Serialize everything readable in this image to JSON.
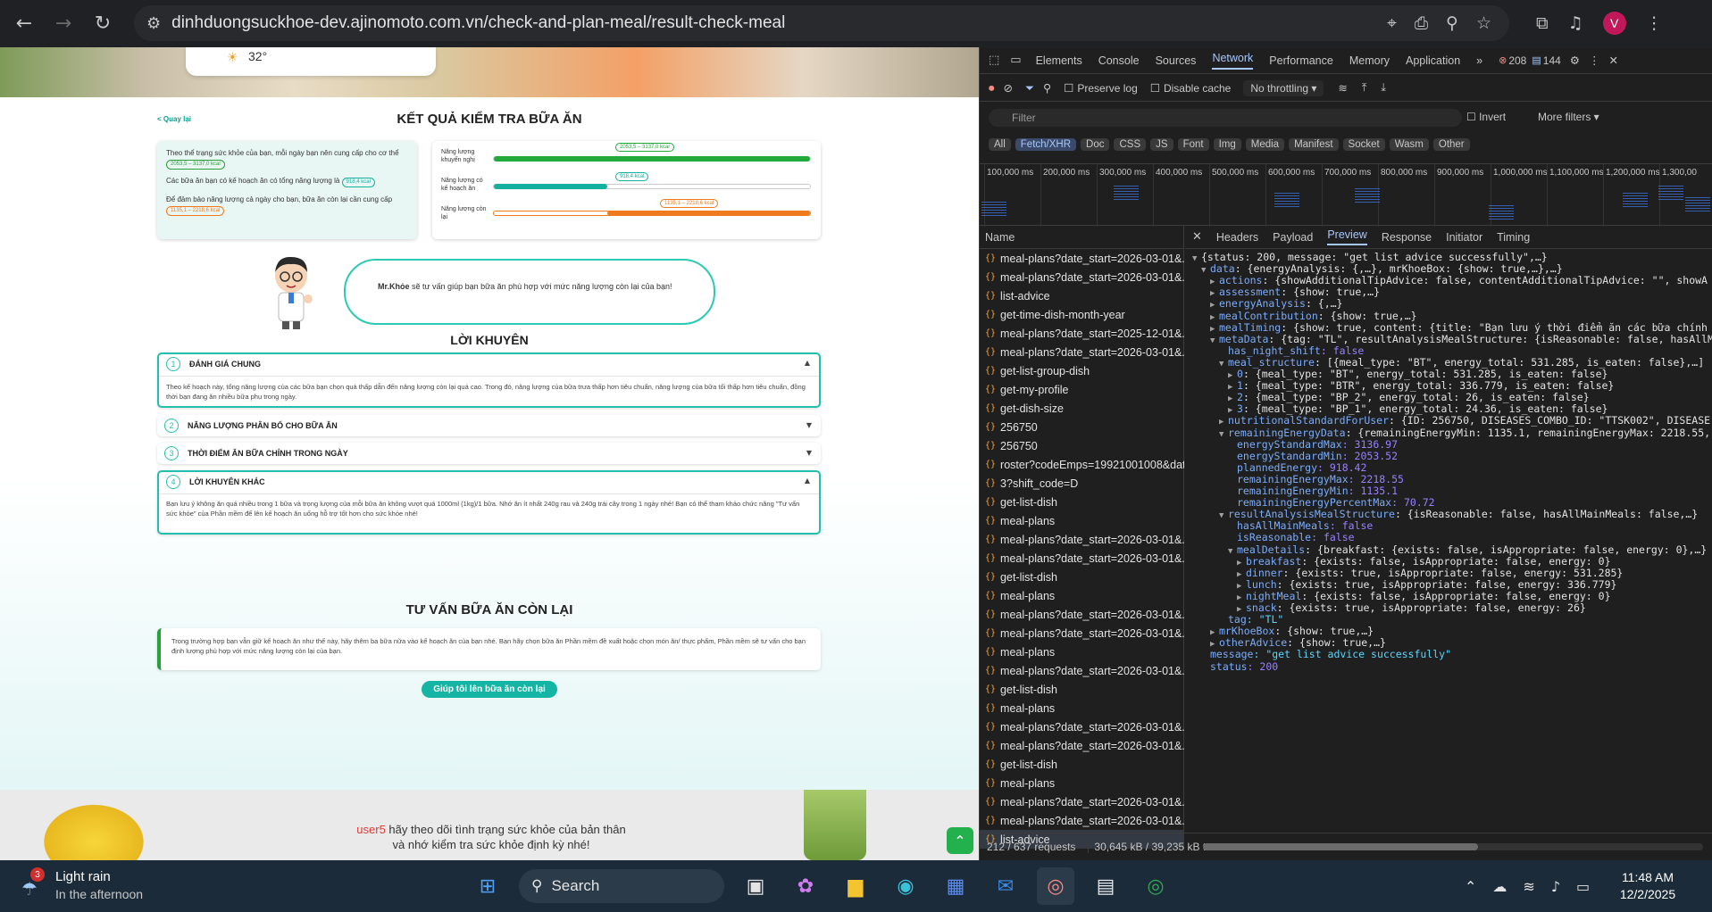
{
  "browser": {
    "url": "dinhduongsuckhoe-dev.ajinomoto.com.vn/check-and-plan-meal/result-check-meal",
    "avatar_letter": "V"
  },
  "page": {
    "weather_temp": "32°",
    "back_link": "< Quay lại",
    "main_title": "KẾT QUẢ KIỂM TRA BỮA ĂN",
    "summary": {
      "line1": "Theo thể trạng sức khỏe của bạn, mỗi ngày bạn nên cung cấp cho cơ thể",
      "line1_pill": "2053,5 – 3137,0 kcal",
      "line2": "Các bữa ăn bạn có kế hoạch ăn có tổng năng lượng là",
      "line2_pill": "918,4 kcal",
      "line3": "Để đảm bảo năng lượng cả ngày cho bạn, bữa ăn còn lại cần cung cấp",
      "line3_pill": "1135,1 – 2218,6 kcal"
    },
    "bars": [
      {
        "label": "Năng lượng khuyến nghị",
        "pill": "2053,5 – 3137,0 kcal",
        "fill_fraction": 1.0,
        "color": "#23a83a"
      },
      {
        "label": "Năng lượng có kế hoạch ăn",
        "pill": "918,4 kcal",
        "fill_fraction": 0.36,
        "color": "#15b0a0"
      },
      {
        "label": "Năng lượng còn lại",
        "pill": "1135,1 – 2218,6 kcal",
        "fill_fraction": 0.64,
        "color": "#f07b1f"
      }
    ],
    "mrkhoe_name": "Mr.Khỏe",
    "mrkhoe_text": " sẽ tư vấn giúp bạn bữa ăn phù hợp với mức năng lượng còn lại của bạn!",
    "advice_title": "LỜI KHUYÊN",
    "accordions": [
      {
        "num": "1",
        "title": "ĐÁNH GIÁ CHUNG",
        "open": true,
        "body": "Theo kế hoạch này, tổng năng lượng của các bữa bạn chọn quá thấp dẫn đến năng lượng còn lại quá cao. Trong đó, năng lượng của bữa trưa thấp hơn tiêu chuẩn, năng lượng của bữa tối thấp hơn tiêu chuẩn, đồng thời bạn đang ăn nhiều bữa phụ trong ngày."
      },
      {
        "num": "2",
        "title": "NĂNG LƯỢNG PHÂN BỔ CHO BỮA ĂN",
        "open": false,
        "body": ""
      },
      {
        "num": "3",
        "title": "THỜI ĐIỂM ĂN BỮA CHÍNH TRONG NGÀY",
        "open": false,
        "body": ""
      },
      {
        "num": "4",
        "title": "LỜI KHUYÊN KHÁC",
        "open": true,
        "body": "Bạn lưu ý không ăn quá nhiều trong 1 bữa và trọng lượng của mỗi bữa ăn không vượt quá 1000ml (1kg)/1 bữa. Nhớ ăn ít nhất 240g rau và 240g trái cây trong 1 ngày nhé! Bạn có thể tham khảo chức năng \"Tư vấn sức khỏe\" của Phần mềm để lên kế hoạch ăn uống hỗ trợ tốt hơn cho sức khỏe nhé!"
      }
    ],
    "remaining_title": "TƯ VẤN BỮA ĂN CÒN LẠI",
    "remaining_text": "Trong trường hợp bạn vẫn giữ kế hoạch ăn như thế này, hãy thêm ba bữa nữa vào kế hoạch ăn của bạn nhé. Bạn hãy chọn bữa ăn Phần mềm đề xuất hoặc chọn món ăn/ thực phẩm, Phần mềm sẽ tư vấn cho bạn định lượng phù hợp với mức năng lượng còn lại của bạn.",
    "cta": "Giúp tôi lên bữa ăn còn lại",
    "footer_user": "user5",
    "footer_text1": " hãy theo dõi tình trạng sức khỏe của bản thân",
    "footer_text2": "và nhớ kiểm tra sức khỏe định kỳ nhé!"
  },
  "devtools": {
    "tabs": [
      "Elements",
      "Console",
      "Sources",
      "Network",
      "Performance",
      "Memory",
      "Application"
    ],
    "active_tab": "Network",
    "errors": "208",
    "messages": "144",
    "preserve_log": "Preserve log",
    "disable_cache": "Disable cache",
    "throttling": "No throttling",
    "filter_placeholder": "Filter",
    "invert": "Invert",
    "more_filters": "More filters",
    "type_filters": [
      "All",
      "Fetch/XHR",
      "Doc",
      "CSS",
      "JS",
      "Font",
      "Img",
      "Media",
      "Manifest",
      "Socket",
      "Wasm",
      "Other"
    ],
    "active_filter": "Fetch/XHR",
    "timeline_ticks": [
      "100,000 ms",
      "200,000 ms",
      "300,000 ms",
      "400,000 ms",
      "500,000 ms",
      "600,000 ms",
      "700,000 ms",
      "800,000 ms",
      "900,000 ms",
      "1,000,000 ms",
      "1,100,000 ms",
      "1,200,000 ms",
      "1,300,00"
    ],
    "name_header": "Name",
    "requests": [
      "meal-plans?date_start=2026-03-01&...",
      "meal-plans?date_start=2026-03-01&...",
      "list-advice",
      "get-time-dish-month-year",
      "meal-plans?date_start=2025-12-01&...",
      "meal-plans?date_start=2026-03-01&...",
      "get-list-group-dish",
      "get-my-profile",
      "get-dish-size",
      "256750",
      "256750",
      "roster?codeEmps=19921001008&dat...",
      "3?shift_code=D",
      "get-list-dish",
      "meal-plans",
      "meal-plans?date_start=2026-03-01&...",
      "meal-plans?date_start=2026-03-01&...",
      "get-list-dish",
      "meal-plans",
      "meal-plans?date_start=2026-03-01&...",
      "meal-plans?date_start=2026-03-01&...",
      "meal-plans",
      "meal-plans?date_start=2026-03-01&...",
      "get-list-dish",
      "meal-plans",
      "meal-plans?date_start=2026-03-01&...",
      "meal-plans?date_start=2026-03-01&...",
      "get-list-dish",
      "meal-plans",
      "meal-plans?date_start=2026-03-01&...",
      "meal-plans?date_start=2026-03-01&...",
      "list-advice"
    ],
    "selected_request": "list-advice",
    "status_requests": "212 / 637 requests",
    "status_transfer": "30,645 kB / 39,235 kB t",
    "preview_tabs": [
      "Headers",
      "Payload",
      "Preview",
      "Response",
      "Initiator",
      "Timing"
    ],
    "active_preview_tab": "Preview",
    "json_lines": [
      {
        "indent": 0,
        "tri": "▼",
        "key": "",
        "text": "{status: 200, message: \"get list advice successfully\",…}"
      },
      {
        "indent": 1,
        "tri": "▼",
        "key": "data",
        "text": ": {energyAnalysis: {,…}, mrKhoeBox: {show: true,…},…}"
      },
      {
        "indent": 2,
        "tri": "▶",
        "key": "actions",
        "text": ": {showAdditionalTipAdvice: false, contentAdditionalTipAdvice: \"\", showA"
      },
      {
        "indent": 2,
        "tri": "▶",
        "key": "assessment",
        "text": ": {show: true,…}"
      },
      {
        "indent": 2,
        "tri": "▶",
        "key": "energyAnalysis",
        "text": ": {,…}"
      },
      {
        "indent": 2,
        "tri": "▶",
        "key": "mealContribution",
        "text": ": {show: true,…}"
      },
      {
        "indent": 2,
        "tri": "▶",
        "key": "mealTiming",
        "text": ": {show: true, content: {title: \"Bạn lưu ý thời điểm ăn các bữa chính"
      },
      {
        "indent": 2,
        "tri": "▼",
        "key": "metaData",
        "text": ": {tag: \"TL\", resultAnalysisMealStructure: {isReasonable: false, hasAllM"
      },
      {
        "indent": 3,
        "tri": "",
        "key": "has_night_shift",
        "text": ": false"
      },
      {
        "indent": 3,
        "tri": "▼",
        "key": "meal_structure",
        "text": ": [{meal_type: \"BT\", energy_total: 531.285, is_eaten: false},…]"
      },
      {
        "indent": 4,
        "tri": "▶",
        "key": "0",
        "text": ": {meal_type: \"BT\", energy_total: 531.285, is_eaten: false}"
      },
      {
        "indent": 4,
        "tri": "▶",
        "key": "1",
        "text": ": {meal_type: \"BTR\", energy_total: 336.779, is_eaten: false}"
      },
      {
        "indent": 4,
        "tri": "▶",
        "key": "2",
        "text": ": {meal_type: \"BP_2\", energy_total: 26, is_eaten: false}"
      },
      {
        "indent": 4,
        "tri": "▶",
        "key": "3",
        "text": ": {meal_type: \"BP_1\", energy_total: 24.36, is_eaten: false}"
      },
      {
        "indent": 3,
        "tri": "▶",
        "key": "nutritionalStandardForUser",
        "text": ": {ID: 256750, DISEASES_COMBO_ID: \"TTSK002\", DISEASE"
      },
      {
        "indent": 3,
        "tri": "▼",
        "key": "remainingEnergyData",
        "text": ": {remainingEnergyMin: 1135.1, remainingEnergyMax: 2218.55,"
      },
      {
        "indent": 4,
        "tri": "",
        "key": "energyStandardMax",
        "text": ": 3136.97"
      },
      {
        "indent": 4,
        "tri": "",
        "key": "energyStandardMin",
        "text": ": 2053.52"
      },
      {
        "indent": 4,
        "tri": "",
        "key": "plannedEnergy",
        "text": ": 918.42"
      },
      {
        "indent": 4,
        "tri": "",
        "key": "remainingEnergyMax",
        "text": ": 2218.55"
      },
      {
        "indent": 4,
        "tri": "",
        "key": "remainingEnergyMin",
        "text": ": 1135.1"
      },
      {
        "indent": 4,
        "tri": "",
        "key": "remainingEnergyPercentMax",
        "text": ": 70.72"
      },
      {
        "indent": 3,
        "tri": "▼",
        "key": "resultAnalysisMealStructure",
        "text": ": {isReasonable: false, hasAllMainMeals: false,…}"
      },
      {
        "indent": 4,
        "tri": "",
        "key": "hasAllMainMeals",
        "text": ": false"
      },
      {
        "indent": 4,
        "tri": "",
        "key": "isReasonable",
        "text": ": false"
      },
      {
        "indent": 4,
        "tri": "▼",
        "key": "mealDetails",
        "text": ": {breakfast: {exists: false, isAppropriate: false, energy: 0},…}"
      },
      {
        "indent": 5,
        "tri": "▶",
        "key": "breakfast",
        "text": ": {exists: false, isAppropriate: false, energy: 0}"
      },
      {
        "indent": 5,
        "tri": "▶",
        "key": "dinner",
        "text": ": {exists: true, isAppropriate: false, energy: 531.285}"
      },
      {
        "indent": 5,
        "tri": "▶",
        "key": "lunch",
        "text": ": {exists: true, isAppropriate: false, energy: 336.779}"
      },
      {
        "indent": 5,
        "tri": "▶",
        "key": "nightMeal",
        "text": ": {exists: false, isAppropriate: false, energy: 0}"
      },
      {
        "indent": 5,
        "tri": "▶",
        "key": "snack",
        "text": ": {exists: true, isAppropriate: false, energy: 26}"
      },
      {
        "indent": 3,
        "tri": "",
        "key": "tag",
        "text": ": \"TL\""
      },
      {
        "indent": 2,
        "tri": "▶",
        "key": "mrKhoeBox",
        "text": ": {show: true,…}"
      },
      {
        "indent": 2,
        "tri": "▶",
        "key": "otherAdvice",
        "text": ": {show: true,…}"
      },
      {
        "indent": 1,
        "tri": "",
        "key": "message",
        "text": ": \"get list advice successfully\""
      },
      {
        "indent": 1,
        "tri": "",
        "key": "status",
        "text": ": 200"
      }
    ]
  },
  "taskbar": {
    "weather_badge": "3",
    "weather_title": "Light rain",
    "weather_sub": "In the afternoon",
    "search": "Search",
    "time": "11:48 AM",
    "date": "12/2/2025"
  }
}
